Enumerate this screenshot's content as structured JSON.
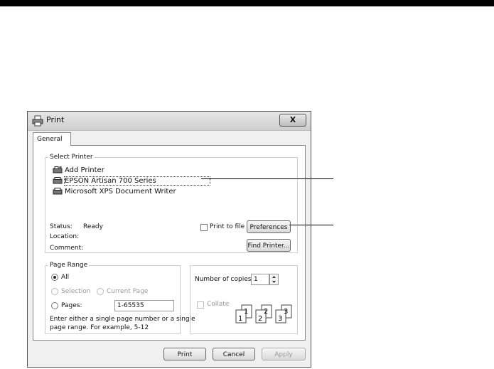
{
  "window": {
    "title": "Print",
    "close_label": "X"
  },
  "tabs": [
    {
      "label": "General"
    }
  ],
  "select_printer": {
    "legend": "Select Printer",
    "printers": [
      {
        "label": "Add Printer"
      },
      {
        "label": "EPSON Artisan 700 Series"
      },
      {
        "label": "Microsoft XPS Document Writer"
      }
    ],
    "status_label": "Status:",
    "status_value": "Ready",
    "location_label": "Location:",
    "location_value": "",
    "comment_label": "Comment:",
    "comment_value": "",
    "print_to_file_label": "Print to file",
    "preferences_label": "Preferences",
    "find_printer_label": "Find Printer..."
  },
  "page_range": {
    "legend": "Page Range",
    "all_label": "All",
    "selection_label": "Selection",
    "current_page_label": "Current Page",
    "pages_label": "Pages:",
    "pages_value": "1-65535",
    "hint_line1": "Enter either a single page number or a single",
    "hint_line2": "page range.  For example, 5-12"
  },
  "copies": {
    "number_label": "Number of copies:",
    "number_value": "1",
    "collate_label": "Collate",
    "collate_pages": [
      "1",
      "1",
      "2",
      "2",
      "3",
      "3"
    ]
  },
  "buttons": {
    "print": "Print",
    "cancel": "Cancel",
    "apply": "Apply"
  }
}
